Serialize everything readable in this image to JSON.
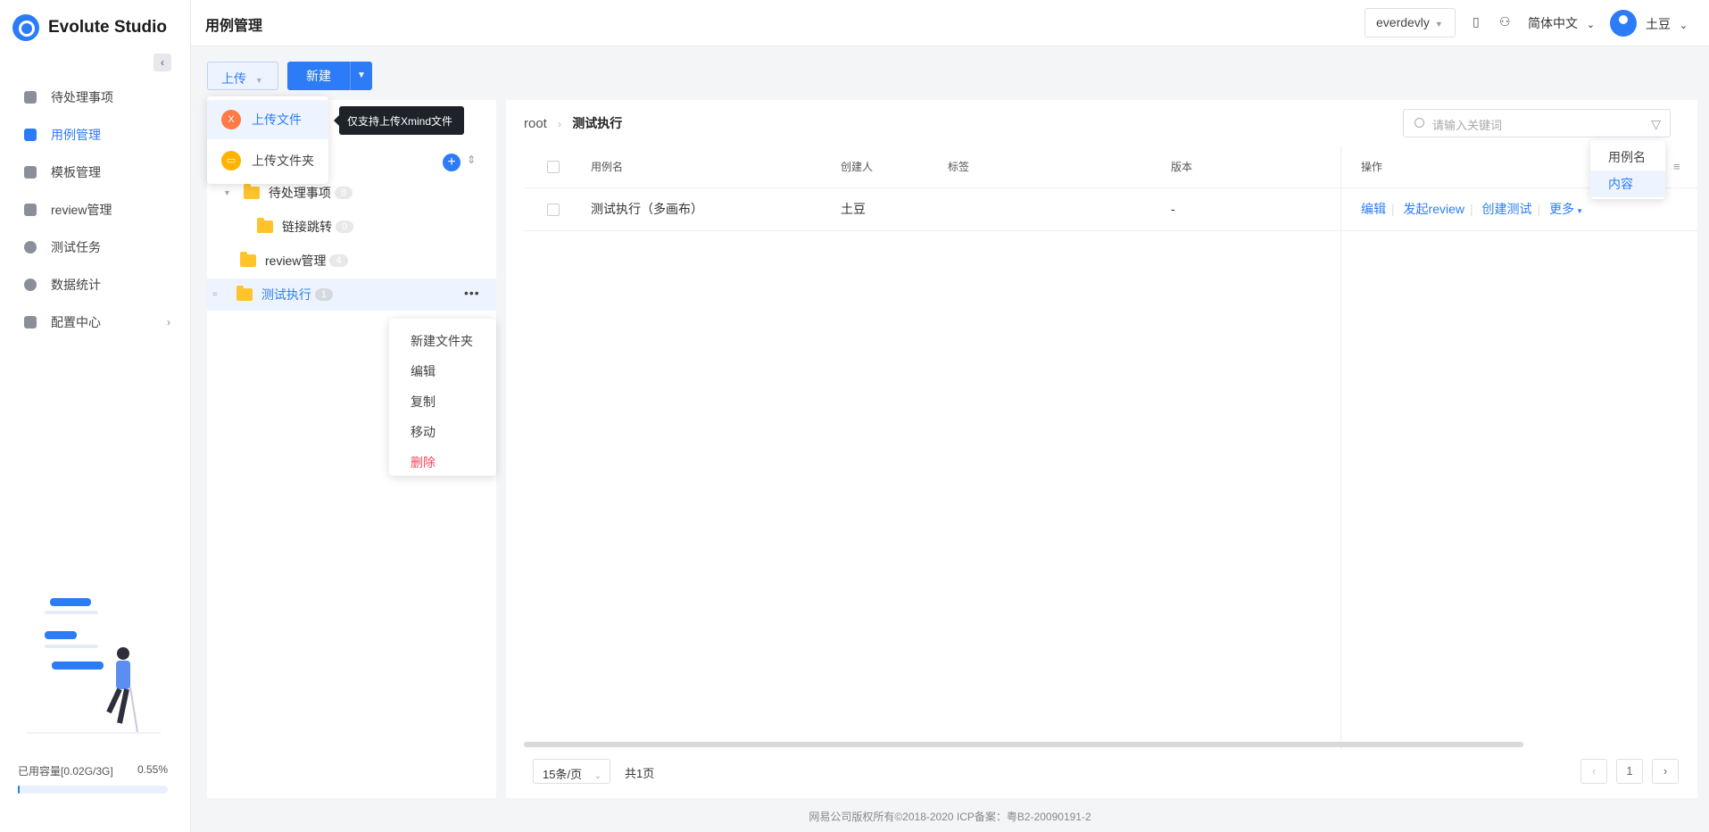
{
  "app": {
    "name": "Evolute Studio",
    "brand_color": "#2b7cf6"
  },
  "header": {
    "title": "用例管理",
    "org": "everdevly",
    "language": "简体中文",
    "user": "土豆"
  },
  "sidebar": {
    "items": [
      {
        "label": "待处理事项",
        "icon": "home-icon"
      },
      {
        "label": "用例管理",
        "icon": "case-icon",
        "active": true
      },
      {
        "label": "模板管理",
        "icon": "template-icon"
      },
      {
        "label": "review管理",
        "icon": "review-icon"
      },
      {
        "label": "测试任务",
        "icon": "play-icon"
      },
      {
        "label": "数据统计",
        "icon": "pie-chart-icon"
      },
      {
        "label": "配置中心",
        "icon": "settings-icon"
      }
    ],
    "storage_label": "已用容量[0.02G/3G]",
    "storage_percent": "0.55%",
    "storage_fraction": 0.0055
  },
  "toolbar": {
    "upload_label": "上传",
    "new_label": "新建"
  },
  "upload_menu": {
    "items": [
      "上传文件",
      "上传文件夹"
    ],
    "tooltip": "仅支持上传Xmind文件"
  },
  "tree": {
    "items": [
      {
        "label": "待处理事项",
        "count": "8"
      },
      {
        "label": "链接跳转",
        "count": "0"
      },
      {
        "label": "review管理",
        "count": "4"
      },
      {
        "label": "测试执行",
        "count": "1"
      }
    ]
  },
  "context_menu": {
    "items": [
      "新建文件夹",
      "编辑",
      "复制",
      "移动",
      "删除"
    ]
  },
  "main": {
    "breadcrumb_root": "root",
    "breadcrumb_current": "测试执行",
    "search_placeholder": "请输入关键词",
    "search_scope": [
      "用例名",
      "内容"
    ],
    "columns": [
      "用例名",
      "创建人",
      "标签",
      "版本",
      "操作"
    ],
    "rows": [
      {
        "name": "测试执行（多画布）",
        "creator": "土豆",
        "tag": "",
        "version": "-"
      }
    ],
    "actions": [
      "编辑",
      "发起review",
      "创建测试",
      "更多"
    ],
    "pager": {
      "size": "15条/页",
      "total": "共1页",
      "page": "1"
    }
  },
  "footer": "网易公司版权所有©2018-2020 ICP备案：粤B2-20090191-2"
}
